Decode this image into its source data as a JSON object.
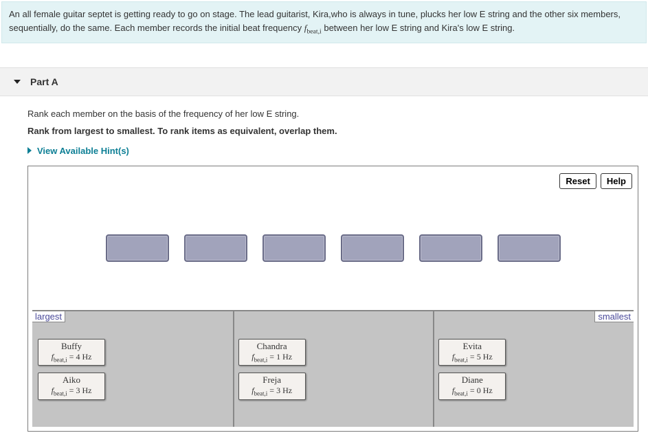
{
  "intro": {
    "text_a": "An all female guitar septet is getting ready to go on stage. The lead guitarist, Kira,who is always in tune, plucks her low E string and the other six members, sequentially, do the same. Each member records the initial beat frequency ",
    "math_symbol": "f",
    "math_sub": "beat,i",
    "text_b": " between her low E string and Kira's low E string."
  },
  "part": {
    "label": "Part A",
    "instruction": "Rank each member on the basis of the frequency of her low E string.",
    "instruction_bold": "Rank from largest to smallest. To rank items as equivalent, overlap them.",
    "hints_label": "View Available Hint(s)"
  },
  "toolbar": {
    "reset": "Reset",
    "help": "Help"
  },
  "rank": {
    "left_label": "largest",
    "right_label": "smallest"
  },
  "tiles": {
    "col1": [
      {
        "name": "Buffy",
        "val": "4 Hz"
      },
      {
        "name": "Aiko",
        "val": "3 Hz"
      }
    ],
    "col2": [
      {
        "name": "Chandra",
        "val": "1 Hz"
      },
      {
        "name": "Freja",
        "val": "3 Hz"
      }
    ],
    "col3": [
      {
        "name": "Evita",
        "val": "5 Hz"
      },
      {
        "name": "Diane",
        "val": "0 Hz"
      }
    ]
  },
  "tile_eq": {
    "f": "f",
    "sub": "beat,i",
    "eq": " = "
  }
}
